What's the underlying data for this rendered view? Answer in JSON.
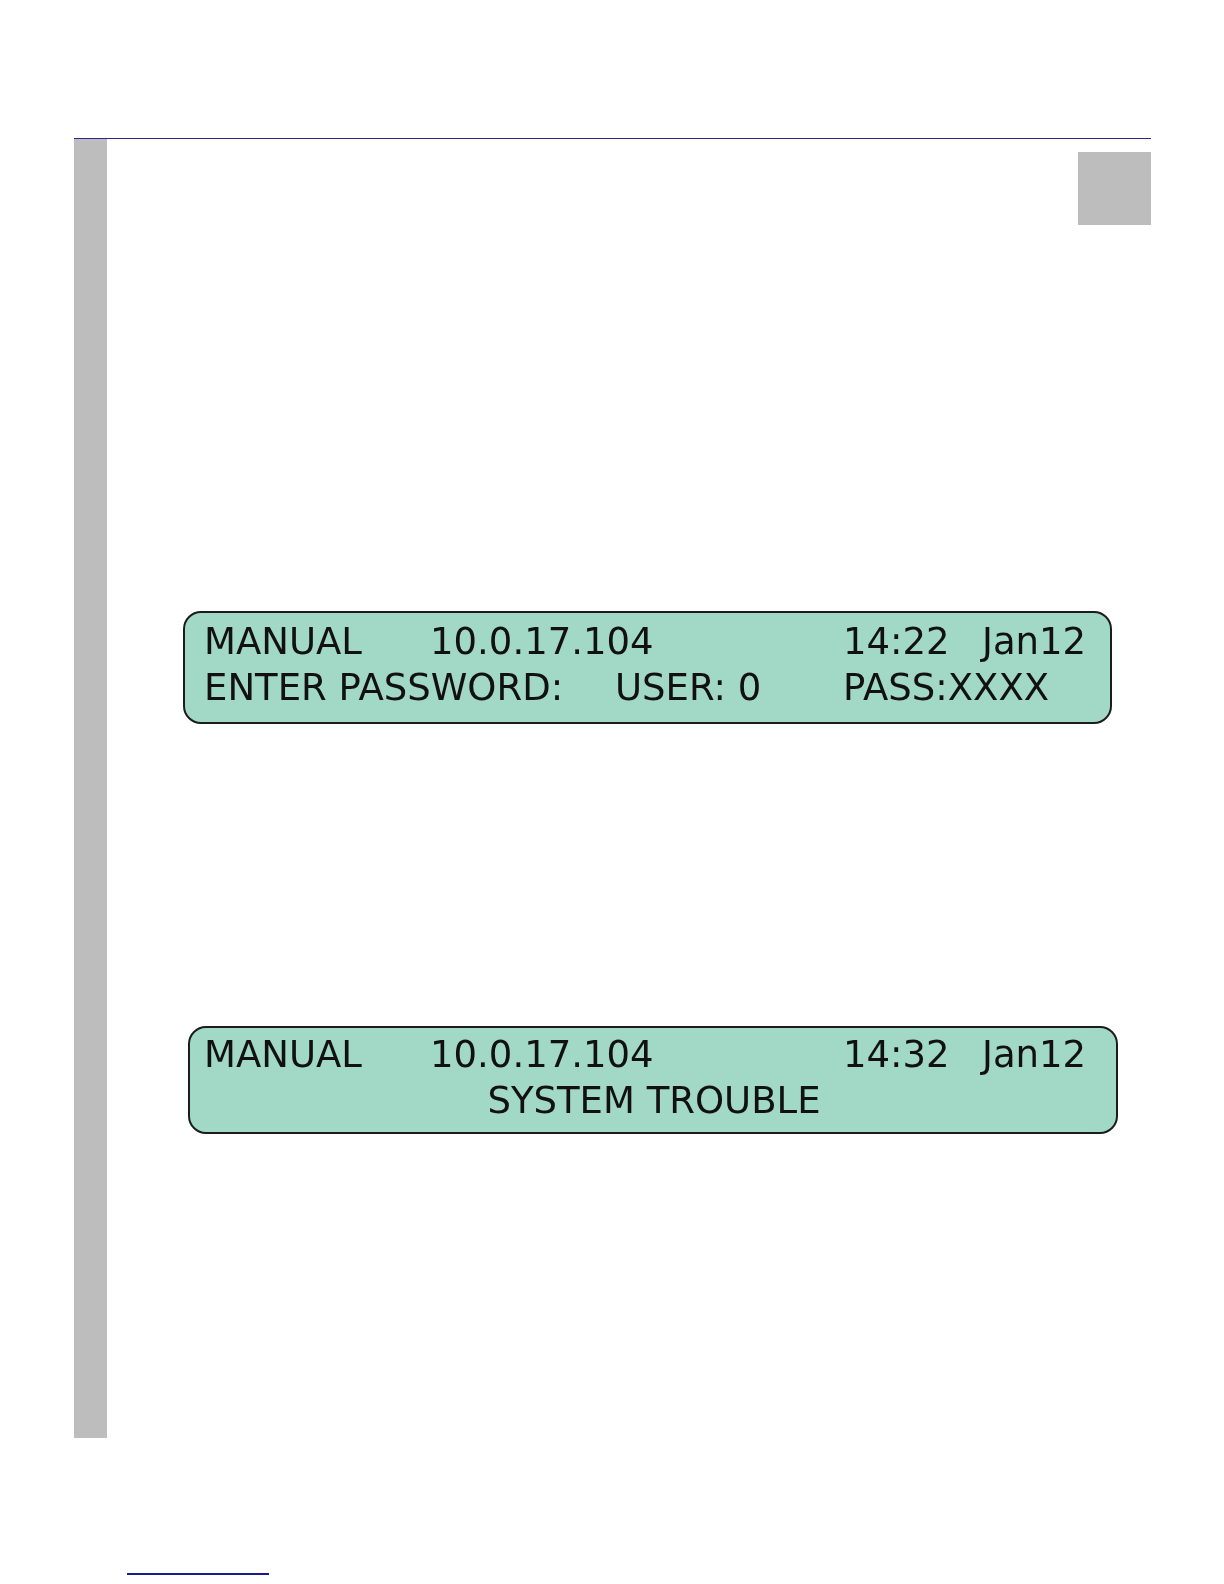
{
  "displays": [
    {
      "rows": [
        {
          "segments": [
            "MANUAL",
            "10.0.17.104",
            "14:22",
            "Jan12"
          ]
        },
        {
          "segments": [
            "ENTER PASSWORD:",
            "USER: 0",
            "PASS:XXXX"
          ]
        }
      ]
    },
    {
      "rows": [
        {
          "segments": [
            "MANUAL",
            "10.0.17.104",
            "14:32",
            "Jan12"
          ]
        },
        {
          "segments": [
            "SYSTEM TROUBLE"
          ]
        }
      ]
    }
  ]
}
